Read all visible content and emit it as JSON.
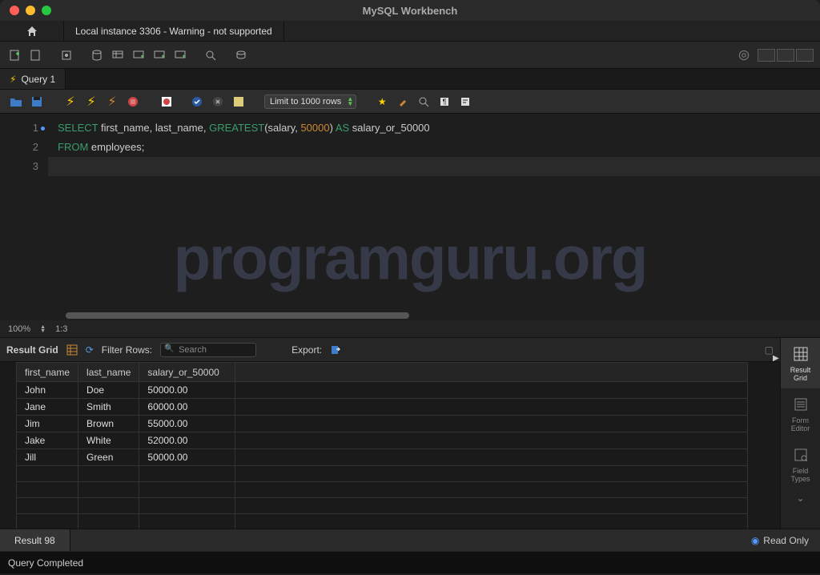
{
  "title": "MySQL Workbench",
  "tabs": {
    "connection": "Local instance 3306 - Warning - not supported"
  },
  "query_tab": {
    "label": "Query 1"
  },
  "limit_selector": "Limit to 1000 rows",
  "sql": {
    "line1": {
      "kw1": "SELECT",
      "p1": " first_name, last_name, ",
      "fn": "GREATEST",
      "p2": "(salary, ",
      "num": "50000",
      "p3": ") ",
      "kw2": "AS",
      "p4": " salary_or_50000"
    },
    "line2": {
      "kw": "FROM",
      "p": " employees;"
    }
  },
  "watermark": "programguru.org",
  "editor_status": {
    "zoom": "100%",
    "pos": "1:3"
  },
  "result_toolbar": {
    "label": "Result Grid",
    "filter_label": "Filter Rows:",
    "search_placeholder": "Search",
    "export_label": "Export:"
  },
  "columns": [
    "first_name",
    "last_name",
    "salary_or_50000"
  ],
  "rows": [
    [
      "John",
      "Doe",
      "50000.00"
    ],
    [
      "Jane",
      "Smith",
      "60000.00"
    ],
    [
      "Jim",
      "Brown",
      "55000.00"
    ],
    [
      "Jake",
      "White",
      "52000.00"
    ],
    [
      "Jill",
      "Green",
      "50000.00"
    ]
  ],
  "side_tabs": {
    "grid": "Result\nGrid",
    "form": "Form\nEditor",
    "field": "Field\nTypes"
  },
  "result_tab": "Result 98",
  "readonly": "Read Only",
  "status": "Query Completed"
}
